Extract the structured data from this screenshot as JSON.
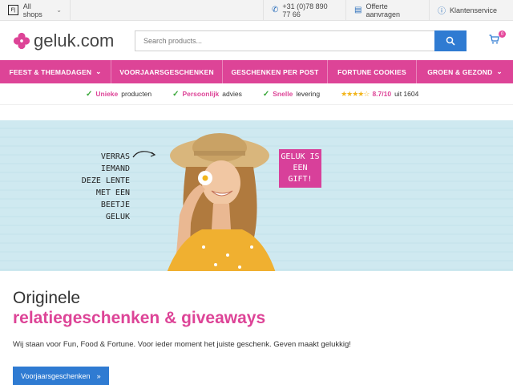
{
  "topbar": {
    "shops_label": "All shops",
    "phone": "+31 (0)78 890 77 66",
    "quote": "Offerte aanvragen",
    "service": "Klantenservice"
  },
  "header": {
    "brand": "geluk.com",
    "search_placeholder": "Search products...",
    "cart_count": "0"
  },
  "nav": {
    "items": [
      {
        "label": "FEEST & THEMADAGEN",
        "has_dropdown": true
      },
      {
        "label": "VOORJAARSGESCHENKEN",
        "has_dropdown": false
      },
      {
        "label": "GESCHENKEN PER POST",
        "has_dropdown": false
      },
      {
        "label": "FORTUNE COOKIES",
        "has_dropdown": false
      },
      {
        "label": "GROEN & GEZOND",
        "has_dropdown": true
      }
    ]
  },
  "usp": {
    "items": [
      {
        "highlight": "Unieke",
        "rest": "producten"
      },
      {
        "highlight": "Persoonlijk",
        "rest": "advies"
      },
      {
        "highlight": "Snelle",
        "rest": "levering"
      }
    ],
    "rating": "8.7/10",
    "rating_suffix": "uit 1604"
  },
  "hero": {
    "tagline_lines": [
      "VERRAS IEMAND",
      "DEZE LENTE",
      "MET EEN",
      "BEETJE GELUK"
    ],
    "badge_lines": [
      "GELUK IS",
      "EEN GIFT!"
    ]
  },
  "intro": {
    "title_line1": "Originele",
    "title_line2": "relatiegeschenken & giveaways",
    "description": "Wij staan voor Fun, Food & Fortune. Voor ieder moment het juiste geschenk. Geven maakt gelukkig!",
    "cta_label": "Voorjaarsgeschenken"
  },
  "colors": {
    "brand_pink": "#dd4497",
    "accent_blue": "#2f7bd2",
    "check_green": "#3aa83a"
  }
}
